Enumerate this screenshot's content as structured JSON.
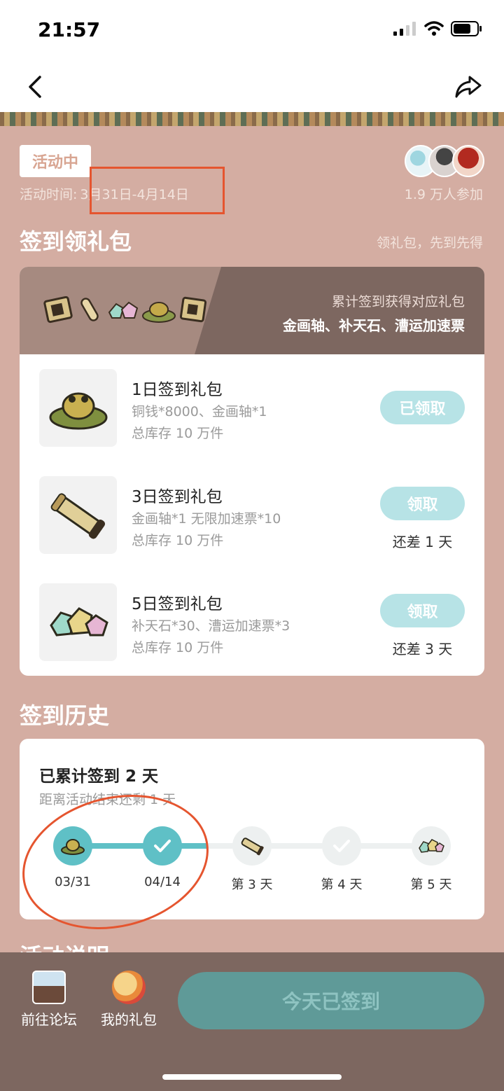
{
  "status_bar": {
    "time": "21:57"
  },
  "activity": {
    "status": "活动中",
    "time_label": "活动时间:",
    "time_range": "3月31日-4月14日",
    "participants": "1.9 万人参加"
  },
  "signin": {
    "title": "签到领礼包",
    "note": "领礼包，先到先得",
    "header_sub": "累计签到获得对应礼包",
    "header_main": "金画轴、补天石、漕运加速票",
    "gifts": [
      {
        "name": "1日签到礼包",
        "desc": "铜钱*8000、金画轴*1",
        "stock": "总库存 10 万件",
        "button": "已领取",
        "remain": ""
      },
      {
        "name": "3日签到礼包",
        "desc": "金画轴*1 无限加速票*10",
        "stock": "总库存 10 万件",
        "button": "领取",
        "remain": "还差 1 天"
      },
      {
        "name": "5日签到礼包",
        "desc": "补天石*30、漕运加速票*3",
        "stock": "总库存 10 万件",
        "button": "领取",
        "remain": "还差 3 天"
      }
    ]
  },
  "history": {
    "title": "签到历史",
    "summary": "已累计签到 2 天",
    "remaining": "距离活动结束还剩 1 天",
    "nodes": [
      "03/31",
      "04/14",
      "第 3 天",
      "第 4 天",
      "第 5 天"
    ],
    "completed_days": 2
  },
  "next_section_title": "活动说明",
  "bottom": {
    "forum": "前往论坛",
    "my_gifts": "我的礼包",
    "checkin": "今天已签到"
  },
  "colors": {
    "background": "#d4ada2",
    "accent_teal": "#5fc0c6",
    "button_light": "#b7e3e6",
    "annotation_red": "#e5552f",
    "bottom_bar": "#7d6760"
  }
}
